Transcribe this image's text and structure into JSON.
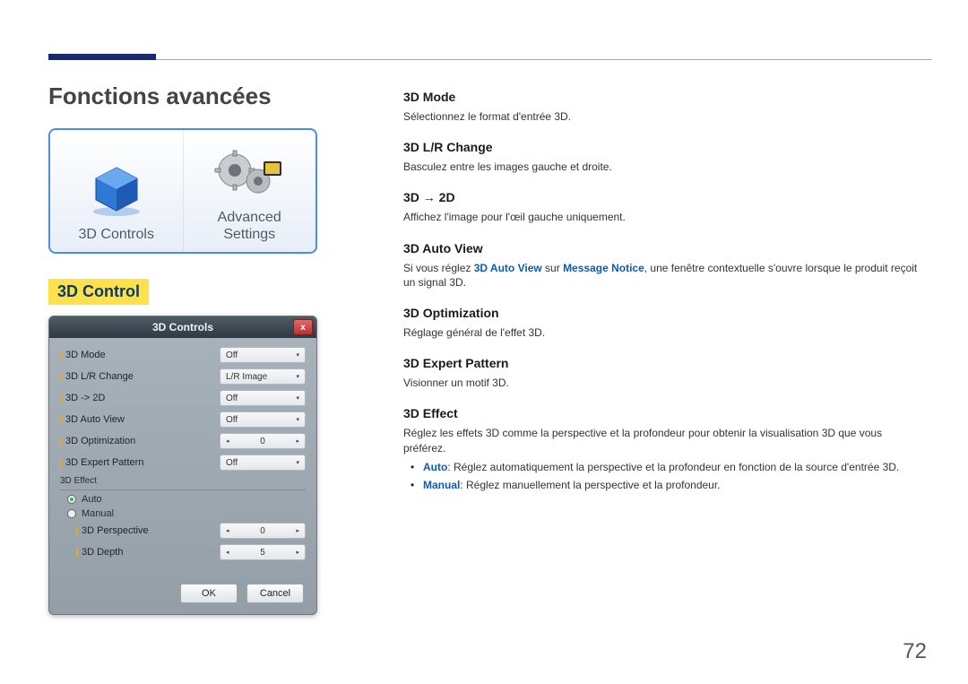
{
  "page": {
    "title": "Fonctions avancées",
    "section_label": "3D Control",
    "number": "72"
  },
  "icons_panel": {
    "items": [
      {
        "icon": "3d-controls-icon",
        "label": "3D Controls"
      },
      {
        "icon": "advanced-settings-icon",
        "label": "Advanced\nSettings"
      }
    ]
  },
  "dialog": {
    "title": "3D Controls",
    "close": "x",
    "rows": [
      {
        "label": "3D Mode",
        "value": "Off"
      },
      {
        "label": "3D L/R Change",
        "value": "L/R Image"
      },
      {
        "label": "3D -> 2D",
        "value": "Off"
      },
      {
        "label": "3D Auto View",
        "value": "Off"
      },
      {
        "label": "3D Optimization",
        "value": "0"
      },
      {
        "label": "3D Expert Pattern",
        "value": "Off"
      }
    ],
    "fieldset_label": "3D Effect",
    "radios": [
      {
        "label": "Auto",
        "selected": true
      },
      {
        "label": "Manual",
        "selected": false
      }
    ],
    "subrows": [
      {
        "label": "3D Perspective",
        "value": "0"
      },
      {
        "label": "3D Depth",
        "value": "5"
      }
    ],
    "buttons": {
      "ok": "OK",
      "cancel": "Cancel"
    }
  },
  "descriptions": {
    "mode": {
      "h": "3D Mode",
      "t": "Sélectionnez le format d'entrée 3D."
    },
    "lrchange": {
      "h": "3D L/R Change",
      "t": "Basculez entre les images gauche et droite."
    },
    "to2d": {
      "h": "3D → 2D",
      "t": "Affichez l'image pour l'œil gauche uniquement."
    },
    "autoview": {
      "h": "3D Auto View",
      "pre": "Si vous réglez ",
      "kw1": "3D Auto View",
      "mid": " sur ",
      "kw2": "Message Notice",
      "post": ", une fenêtre contextuelle s'ouvre lorsque le produit reçoit un signal 3D."
    },
    "optimization": {
      "h": "3D Optimization",
      "t": "Réglage général de l'effet 3D."
    },
    "expert": {
      "h": "3D Expert Pattern",
      "t": "Visionner un motif 3D."
    },
    "effect": {
      "h": "3D Effect",
      "t": "Réglez les effets 3D comme la perspective et la profondeur pour obtenir la visualisation 3D que vous préférez.",
      "bullets": [
        {
          "kw": "Auto",
          "rest": ": Réglez automatiquement la perspective et la profondeur en fonction de la source d'entrée 3D."
        },
        {
          "kw": "Manual",
          "rest": ": Réglez manuellement la perspective et la profondeur."
        }
      ]
    }
  }
}
